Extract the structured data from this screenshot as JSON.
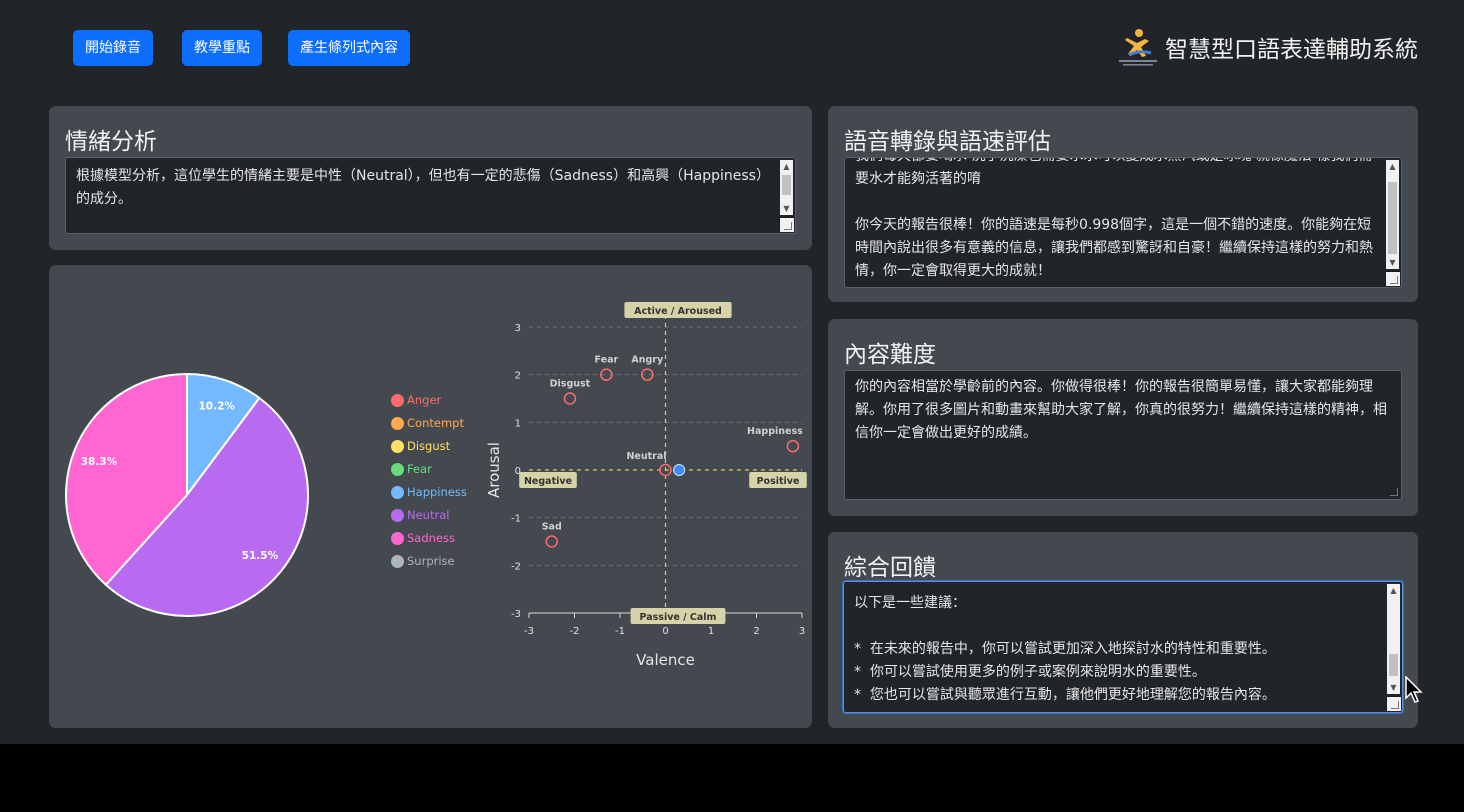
{
  "toolbar": {
    "start_recording": "開始錄音",
    "teaching_points": "教學重點",
    "generate_list": "產生條列式內容"
  },
  "header": {
    "title": "智慧型口語表達輔助系統",
    "logo_icon": "person-figure-logo-icon"
  },
  "emotion": {
    "title": "情緒分析",
    "text": "根據模型分析，這位學生的情緒主要是中性（Neutral），但也有一定的悲傷（Sadness）和高興（Happiness）的成分。"
  },
  "transcription": {
    "title": "語音轉錄與語速評估",
    "text": "我們每天都要喝水 洗手洗澡也需要水水可以變成水蒸汽或是冰塊 就像魔法 樣我們需要水才能夠活著的唷\n\n你今天的報告很棒！你的語速是每秒0.998個字，這是一個不錯的速度。你能夠在短時間內說出很多有意義的信息，讓我們都感到驚訝和自豪！繼續保持這樣的努力和熱情，你一定會取得更大的成就！"
  },
  "difficulty": {
    "title": "內容難度",
    "text": "你的內容相當於學齡前的內容。你做得很棒！你的報告很簡單易懂，讓大家都能夠理解。你用了很多圖片和動畫來幫助大家了解，你真的很努力！繼續保持這樣的精神，相信你一定會做出更好的成績。"
  },
  "feedback": {
    "title": "綜合回饋",
    "text": "以下是一些建議：\n\n*  在未來的報告中，你可以嘗試更加深入地探討水的特性和重要性。\n*  你可以嘗試使用更多的例子或案例來說明水的重要性。\n*  您也可以嘗試與聽眾進行互動，讓他們更好地理解您的報告內容。"
  },
  "colors": {
    "Anger": "#ff6b6b",
    "Contempt": "#ffa94d",
    "Disgust": "#ffe066",
    "Fear": "#69db7c",
    "Happiness": "#74b9ff",
    "Neutral": "#b86bf0",
    "Sadness": "#ff66d1",
    "Surprise": "#adb5bd",
    "accent": "#0d6efd"
  },
  "chart_data": [
    {
      "type": "pie",
      "legend": [
        "Anger",
        "Contempt",
        "Disgust",
        "Fear",
        "Happiness",
        "Neutral",
        "Sadness",
        "Surprise"
      ],
      "slices": [
        {
          "name": "Happiness",
          "value": 10.2,
          "label": "10.2%"
        },
        {
          "name": "Neutral",
          "value": 51.5,
          "label": "51.5%"
        },
        {
          "name": "Sadness",
          "value": 38.3,
          "label": "38.3%"
        }
      ],
      "legend_placement": "right"
    },
    {
      "type": "scatter",
      "xlabel": "Valence",
      "ylabel": "Arousal",
      "xlim": [
        -3,
        3
      ],
      "ylim": [
        -3,
        3
      ],
      "xticks": [
        -3,
        -2,
        -1,
        0,
        1,
        2,
        3
      ],
      "yticks": [
        -3,
        -2,
        -1,
        0,
        1,
        2,
        3
      ],
      "grid": true,
      "axis_annotations": {
        "top": "Active / Aroused",
        "bottom": "Passive / Calm",
        "left": "Negative",
        "right": "Positive"
      },
      "points": [
        {
          "name": "Fear",
          "x": -1.3,
          "y": 2.0
        },
        {
          "name": "Angry",
          "x": -0.4,
          "y": 2.0
        },
        {
          "name": "Disgust",
          "x": -2.1,
          "y": 1.5
        },
        {
          "name": "Happiness",
          "x": 2.8,
          "y": 0.5
        },
        {
          "name": "Neutral",
          "x": 0.0,
          "y": 0.0
        },
        {
          "name": "Sad",
          "x": -2.5,
          "y": -1.5
        }
      ],
      "current_point": {
        "x": 0.3,
        "y": 0.0
      }
    }
  ]
}
